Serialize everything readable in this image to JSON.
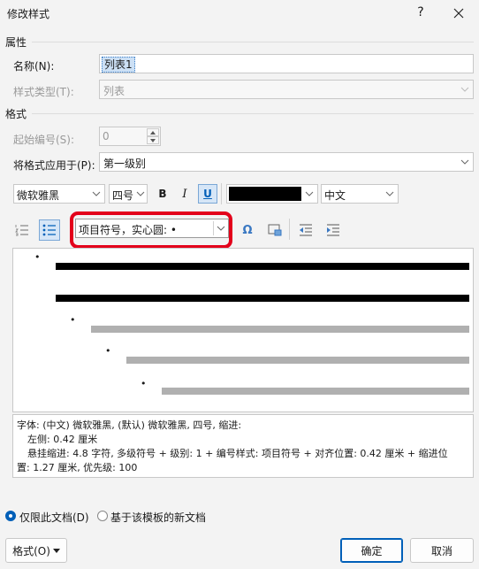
{
  "window": {
    "title": "修改样式",
    "help": "?",
    "close_icon": "close-icon"
  },
  "properties": {
    "section": "属性",
    "name_label": "名称(N):",
    "name_value": "列表1",
    "style_type_label": "样式类型(T):",
    "style_type_value": "列表"
  },
  "format": {
    "section": "格式",
    "start_label": "起始编号(S):",
    "start_value": "0",
    "apply_label": "将格式应用于(P):",
    "apply_value": "第一级别",
    "font_name": "微软雅黑",
    "font_size": "四号",
    "bold": "B",
    "italic": "I",
    "underline": "U",
    "font_color": "#000000",
    "script": "中文",
    "bullet_style": "项目符号，实心圆: •",
    "symbol_glyph": "Ω"
  },
  "preview": {
    "bullet": "•"
  },
  "description": {
    "line1": "字体: (中文) 微软雅黑, (默认) 微软雅黑, 四号, 缩进:",
    "line2": "左侧:  0.42 厘米",
    "line3": "悬挂缩进: 4.8 字符, 多级符号 + 级别: 1 + 编号样式: 项目符号 + 对齐位置:  0.42 厘米 + 缩进位",
    "line4": "置:  1.27 厘米, 优先级: 100"
  },
  "options": {
    "only_this_doc": "仅限此文档(D)",
    "new_docs_template": "基于该模板的新文档"
  },
  "buttons": {
    "format": "格式(O)",
    "ok": "确定",
    "cancel": "取消"
  },
  "colors": {
    "accent": "#005fb8",
    "highlight": "#e3001b",
    "selection": "#cce0f5"
  }
}
